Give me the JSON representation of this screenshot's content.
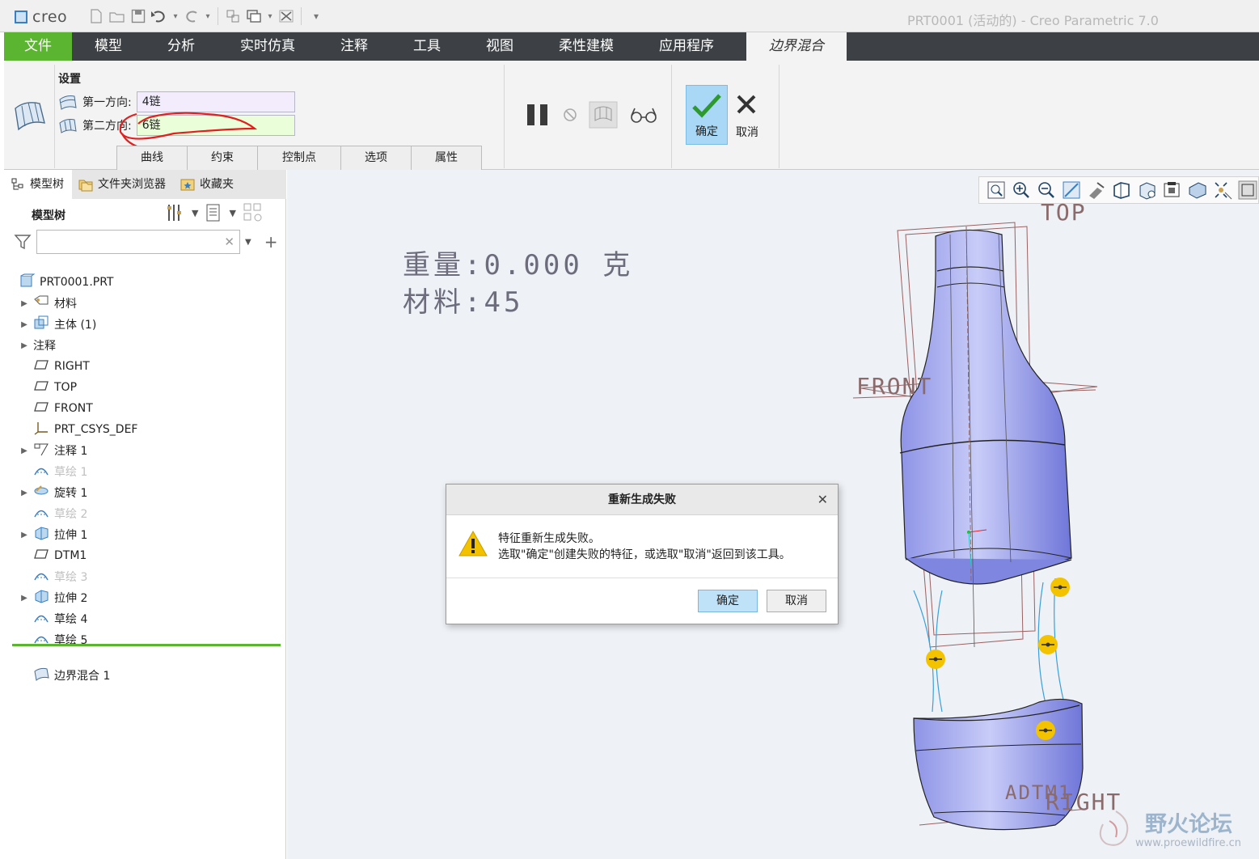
{
  "titlebar": {
    "logo": "creo",
    "window_title": "PRT0001 (活动的) - Creo Parametric 7.0",
    "qat_icons": [
      "new-icon",
      "open-icon",
      "save-icon",
      "undo-icon",
      "redo-icon",
      "regenerate-icon",
      "windows-icon",
      "close-window-icon",
      "customize-icon"
    ]
  },
  "ribbon_tabs": [
    "文件",
    "模型",
    "分析",
    "实时仿真",
    "注释",
    "工具",
    "视图",
    "柔性建模",
    "应用程序"
  ],
  "active_tab": "边界混合",
  "ribbon": {
    "settings_title": "设置",
    "dir1_label": "第一方向:",
    "dir1_value": "4链",
    "dir2_label": "第二方向:",
    "dir2_value": "6链",
    "subtabs": [
      "曲线",
      "约束",
      "控制点",
      "选项",
      "属性"
    ],
    "ok_label": "确定",
    "cancel_label": "取消"
  },
  "nav": {
    "tabs": [
      "模型树",
      "文件夹浏览器",
      "收藏夹"
    ],
    "tree_header": "模型树"
  },
  "tree": [
    {
      "label": "PRT0001.PRT",
      "arrow": "",
      "icon": "part-icon",
      "dim": false,
      "indent": 0
    },
    {
      "label": "材料",
      "arrow": "▶",
      "icon": "material-icon",
      "dim": false,
      "indent": 1
    },
    {
      "label": "主体 (1)",
      "arrow": "▶",
      "icon": "body-icon",
      "dim": false,
      "indent": 1
    },
    {
      "label": "注释",
      "arrow": "▶",
      "icon": "",
      "dim": false,
      "indent": 0
    },
    {
      "label": "RIGHT",
      "arrow": "",
      "icon": "datum-plane-icon",
      "dim": false,
      "indent": 1
    },
    {
      "label": "TOP",
      "arrow": "",
      "icon": "datum-plane-icon",
      "dim": false,
      "indent": 1
    },
    {
      "label": "FRONT",
      "arrow": "",
      "icon": "datum-plane-icon",
      "dim": false,
      "indent": 1
    },
    {
      "label": "PRT_CSYS_DEF",
      "arrow": "",
      "icon": "csys-icon",
      "dim": false,
      "indent": 1
    },
    {
      "label": "注释 1",
      "arrow": "▶",
      "icon": "annotation-icon",
      "dim": false,
      "indent": 1
    },
    {
      "label": "草绘 1",
      "arrow": "",
      "icon": "sketch-icon",
      "dim": true,
      "indent": 1
    },
    {
      "label": "旋转 1",
      "arrow": "▶",
      "icon": "revolve-icon",
      "dim": false,
      "indent": 1
    },
    {
      "label": "草绘 2",
      "arrow": "",
      "icon": "sketch-icon",
      "dim": true,
      "indent": 1
    },
    {
      "label": "拉伸 1",
      "arrow": "▶",
      "icon": "extrude-icon",
      "dim": false,
      "indent": 1
    },
    {
      "label": "DTM1",
      "arrow": "",
      "icon": "datum-plane-icon",
      "dim": false,
      "indent": 1
    },
    {
      "label": "草绘 3",
      "arrow": "",
      "icon": "sketch-icon",
      "dim": true,
      "indent": 1
    },
    {
      "label": "拉伸 2",
      "arrow": "▶",
      "icon": "extrude-icon",
      "dim": false,
      "indent": 1
    },
    {
      "label": "草绘 4",
      "arrow": "",
      "icon": "sketch-icon",
      "dim": false,
      "indent": 1
    },
    {
      "label": "草绘 5",
      "arrow": "",
      "icon": "sketch-icon",
      "dim": false,
      "indent": 1
    },
    {
      "label": "边界混合 1",
      "arrow": "",
      "icon": "boundary-blend-icon",
      "dim": false,
      "indent": 1
    }
  ],
  "graphics": {
    "annotation_line1": "重量:0.000 克",
    "annotation_line2": "材料:45",
    "planes": [
      "TOP",
      "FRONT",
      "RIGHT",
      "ADTM1"
    ]
  },
  "dialog": {
    "title": "重新生成失败",
    "message_line1": "特征重新生成失败。",
    "message_line2": "选取\"确定\"创建失败的特征，或选取\"取消\"返回到该工具。",
    "ok_label": "确定",
    "cancel_label": "取消"
  },
  "watermark": {
    "title": "野火论坛",
    "url": "www.proewildfire.cn"
  }
}
